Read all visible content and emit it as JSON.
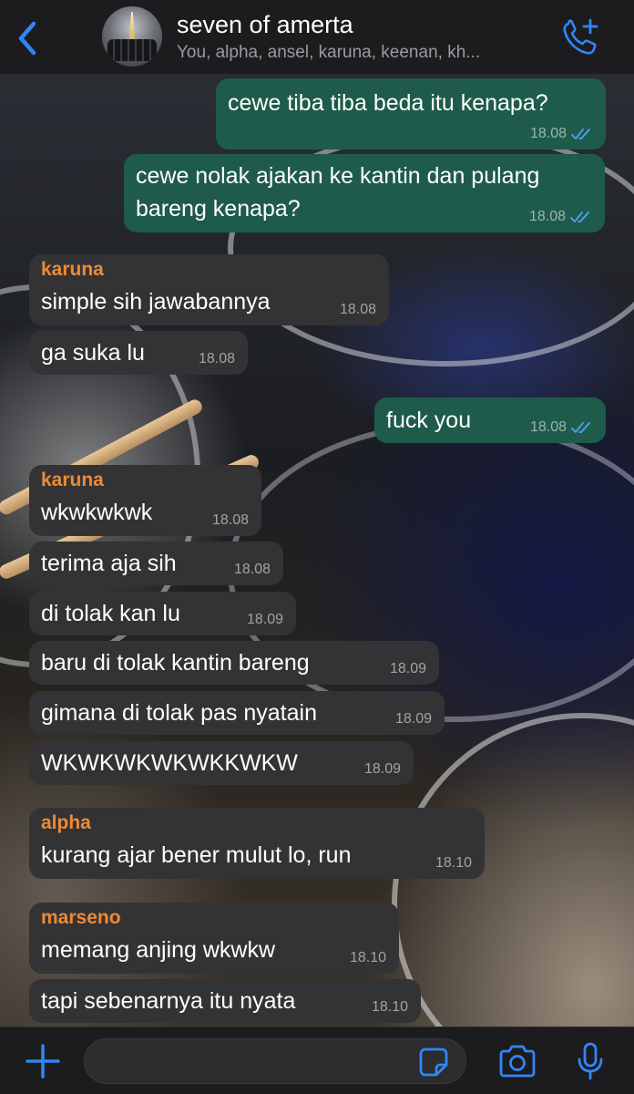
{
  "header": {
    "title": "seven of amerta",
    "subtitle": "You, alpha, ansel, karuna, keenan, kh..."
  },
  "colors": {
    "accent": "#2f87f5",
    "outgoing_bubble": "#1f5b4a",
    "incoming_bubble": "#333335",
    "sender_name": "#ee8a36",
    "read_ticks": "#4fa3f7"
  },
  "icons": {
    "back": "chevron-left",
    "call": "phone-plus",
    "attach": "plus",
    "sticker": "sticker",
    "camera": "camera",
    "microphone": "microphone"
  },
  "messages": [
    {
      "direction": "out",
      "text": "cewe tiba tiba beda itu kenapa?",
      "time": "18.08",
      "status": "read"
    },
    {
      "direction": "out",
      "text_lines": [
        "cewe nolak ajakan ke kantin dan pulang",
        "bareng kenapa?"
      ],
      "time": "18.08",
      "status": "read"
    },
    {
      "direction": "in",
      "sender": "karuna",
      "text": "simple sih jawabannya",
      "time": "18.08"
    },
    {
      "direction": "in",
      "text": "ga suka lu",
      "time": "18.08"
    },
    {
      "direction": "out",
      "text": "fuck you",
      "time": "18.08",
      "status": "read"
    },
    {
      "direction": "in",
      "sender": "karuna",
      "text": "wkwkwkwk",
      "time": "18.08"
    },
    {
      "direction": "in",
      "text": "terima aja sih",
      "time": "18.08"
    },
    {
      "direction": "in",
      "text": "di tolak kan lu",
      "time": "18.09"
    },
    {
      "direction": "in",
      "text": "baru di tolak kantin bareng",
      "time": "18.09"
    },
    {
      "direction": "in",
      "text": "gimana di tolak pas nyatain",
      "time": "18.09"
    },
    {
      "direction": "in",
      "text": "WKWKWKWKWKKWKW",
      "time": "18.09"
    },
    {
      "direction": "in",
      "sender": "alpha",
      "text": "kurang ajar bener mulut lo, run",
      "time": "18.10"
    },
    {
      "direction": "in",
      "sender": "marseno",
      "text": "memang anjing wkwkw",
      "time": "18.10"
    },
    {
      "direction": "in",
      "text": "tapi sebenarnya itu nyata",
      "time": "18.10"
    }
  ],
  "composer": {
    "value": "",
    "placeholder": ""
  }
}
